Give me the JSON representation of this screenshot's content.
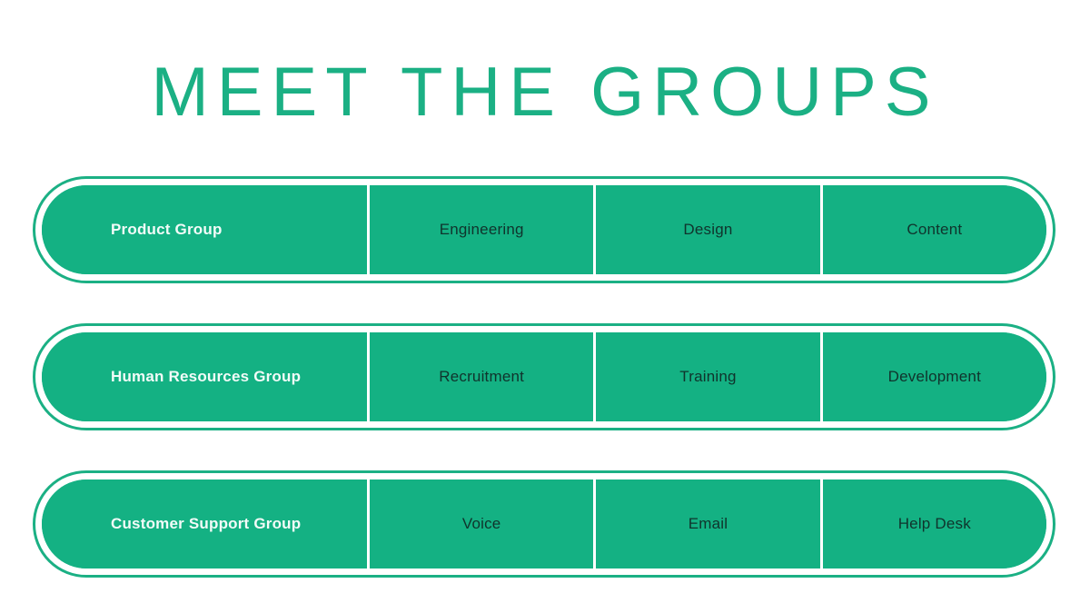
{
  "slide": {
    "title": "MEET THE GROUPS",
    "background_color": "#ffffff",
    "accent_color": "#14b183",
    "title_color": "#1bb084",
    "group_label_color": "#f2fbf8",
    "item_label_color": "#10332c"
  },
  "rows": [
    {
      "group": "Product Group",
      "items": [
        "Engineering",
        "Design",
        "Content"
      ]
    },
    {
      "group": "Human Resources Group",
      "items": [
        "Recruitment",
        "Training",
        "Development"
      ]
    },
    {
      "group": "Customer Support Group",
      "items": [
        "Voice",
        "Email",
        "Help Desk"
      ]
    }
  ]
}
